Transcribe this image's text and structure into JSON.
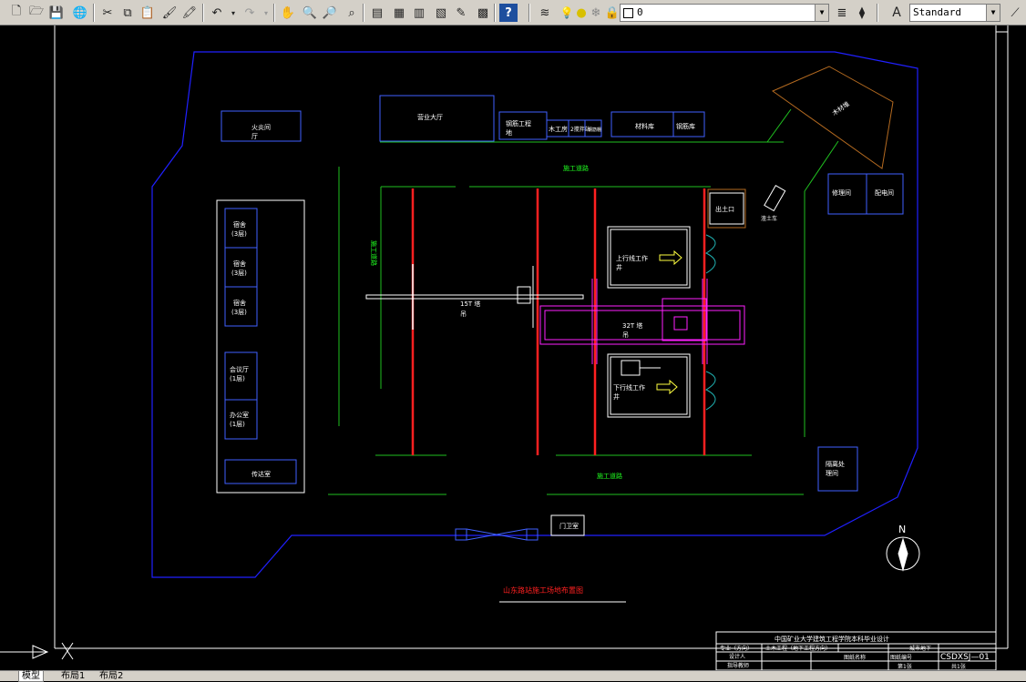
{
  "toolbar": {
    "layer_value": "0",
    "style_value": "Standard",
    "icons": [
      "new-icon",
      "open-icon",
      "save-icon",
      "plot-icon",
      "cut-icon",
      "copy-icon",
      "paste-icon",
      "match-properties-icon",
      "brush-icon",
      "undo-icon",
      "redo-icon",
      "pan-icon",
      "zoom-realtime-icon",
      "zoom-window-icon",
      "zoom-previous-icon",
      "properties-icon",
      "design-center-icon",
      "tool-palette-icon",
      "sheet-set-icon",
      "markup-icon",
      "calculator-icon",
      "help-icon",
      "layer-manager-icon",
      "layer-previous-icon",
      "text-style-icon",
      "dim-icon"
    ]
  },
  "drawing": {
    "labels": {
      "fire_room": "火炎间",
      "fire_room_sub": "厅",
      "business_hall": "营业大厅",
      "rebar_shop": "钢筋工程",
      "rebar_shop_sub": "地",
      "carpentry": "木工房",
      "mixing_station": "2搅拌站",
      "small_shed": "钢筋棚",
      "material_yard": "材料库",
      "material_yard2": "钢筋库",
      "wood_stack": "木材堆",
      "construction_road_top": "施工道路",
      "construction_road_left": "施工道路",
      "construction_road_bottom": "施工道路",
      "dormitory1": "宿舍",
      "dormitory1_sub": "(3层)",
      "dormitory2": "宿舍",
      "dormitory2_sub": "(3层)",
      "dormitory3": "宿舍",
      "dormitory3_sub": "(3层)",
      "meeting_room": "会议厅",
      "meeting_room_sub": "(1层)",
      "office": "办公室",
      "office_sub": "(1层)",
      "guard_room": "传达室",
      "crane_15t": "15T 塔",
      "crane_15t_sub": "吊",
      "crane_32t": "32T 塔",
      "crane_32t_sub": "吊",
      "upper_line": "上行线工作",
      "upper_line_sub": "井",
      "lower_line": "下行线工作",
      "lower_line_sub": "井",
      "exit": "出土口",
      "truck": "渣土车",
      "repair_shop": "修理间",
      "power_room": "配电间",
      "treatment_room": "隔离处",
      "treatment_room_sub": "理间",
      "gate": "门卫室",
      "plan_title": "山东路站施工场地布置图",
      "north": "N"
    },
    "title_block": {
      "school": "中国矿业大学建筑工程学院本科毕业设计",
      "major_label": "专业（方向）",
      "major_value": "土木工程（地下工程方向）",
      "designer": "设计人",
      "advisor": "指导教师",
      "sheet_name": "图纸名称",
      "drawing_no_label": "图纸编号",
      "drawing_no": "CSDXSJ—01",
      "graduation": "城市地下",
      "sheet_count": "共1张",
      "sheet_index": "第1张"
    }
  },
  "tabs": [
    "模型",
    "布局1",
    "布局2"
  ]
}
